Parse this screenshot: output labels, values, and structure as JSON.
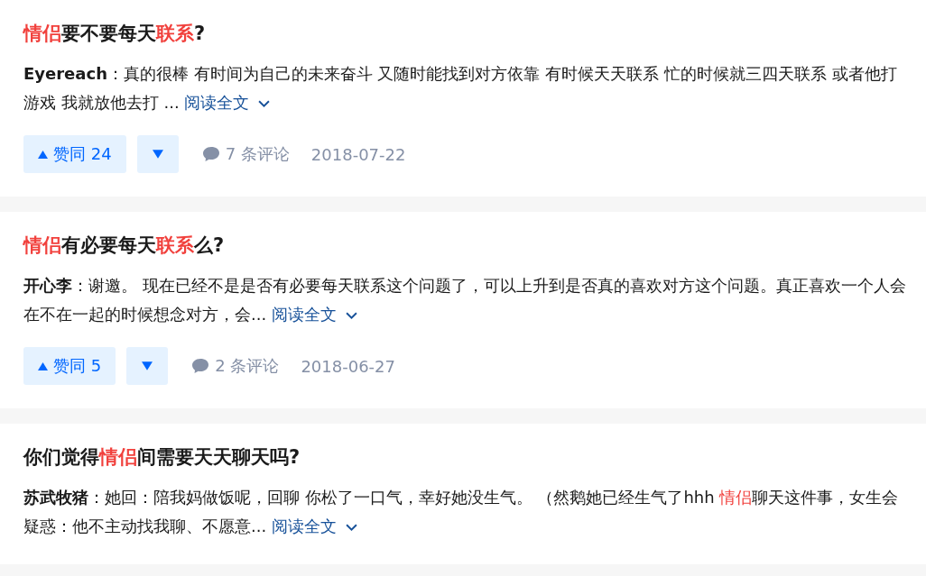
{
  "results": [
    {
      "title": [
        {
          "text": "情侣",
          "highlight": true
        },
        {
          "text": "要不要每天",
          "highlight": false
        },
        {
          "text": "联系",
          "highlight": true
        },
        {
          "text": "?",
          "highlight": false
        }
      ],
      "author": "Eyereach",
      "excerpt": [
        {
          "text": "：真的很棒 有时间为自己的未来奋斗 又随时能找到对方依靠 有时候天天联系 忙的时候就三四天联系 或者他打游戏 我就放他去打 ...",
          "highlight": false
        }
      ],
      "read_more": "阅读全文",
      "upvote": "赞同 24",
      "comments": "7 条评论",
      "date": "2018-07-22"
    },
    {
      "title": [
        {
          "text": "情侣",
          "highlight": true
        },
        {
          "text": "有必要每天",
          "highlight": false
        },
        {
          "text": "联系",
          "highlight": true
        },
        {
          "text": "么?",
          "highlight": false
        }
      ],
      "author": "开心李",
      "excerpt": [
        {
          "text": "：谢邀。 现在已经不是是否有必要每天联系这个问题了，可以上升到是否真的喜欢对方这个问题。真正喜欢一个人会在不在一起的时候想念对方，会...",
          "highlight": false
        }
      ],
      "read_more": "阅读全文",
      "upvote": "赞同 5",
      "comments": "2 条评论",
      "date": "2018-06-27"
    },
    {
      "title": [
        {
          "text": "你们觉得",
          "highlight": false
        },
        {
          "text": "情侣",
          "highlight": true
        },
        {
          "text": "间需要天天聊天吗?",
          "highlight": false
        }
      ],
      "author": "苏武牧猪",
      "excerpt": [
        {
          "text": "：她回：陪我妈做饭呢，回聊 你松了一口气，幸好她没生气。 （然鹅她已经生气了hhh ",
          "highlight": false
        },
        {
          "text": "情侣",
          "highlight": true
        },
        {
          "text": "聊天这件事，女生会疑惑：他不主动找我聊、不愿意...",
          "highlight": false
        }
      ],
      "read_more": "阅读全文"
    }
  ]
}
